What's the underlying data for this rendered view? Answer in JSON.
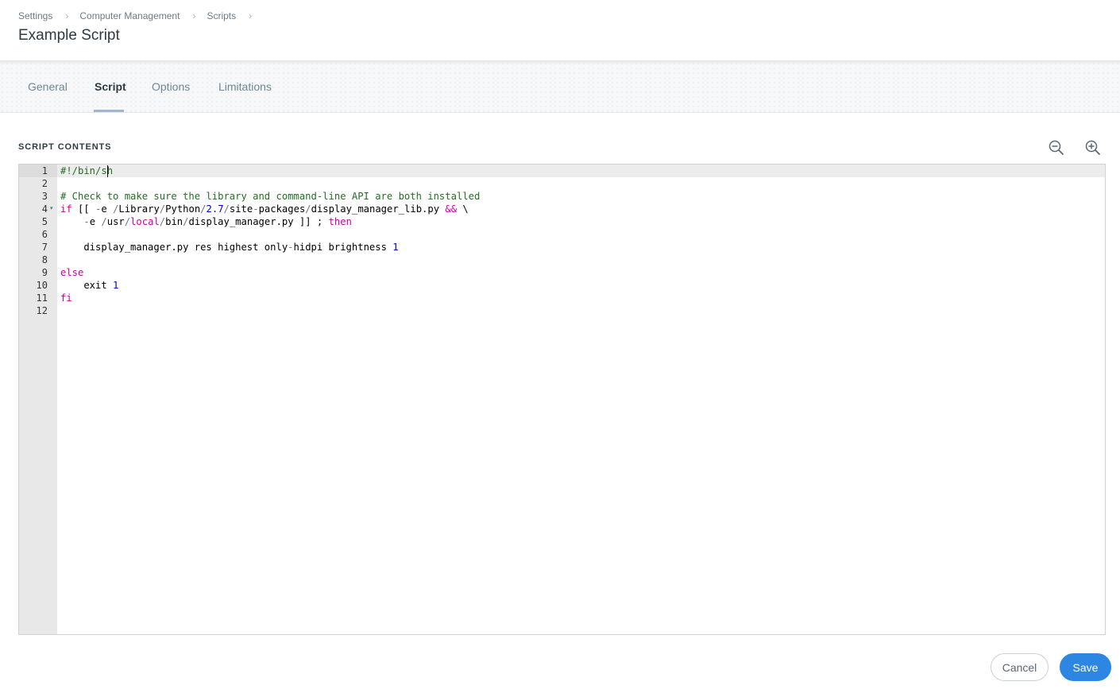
{
  "breadcrumb": {
    "items": [
      "Settings",
      "Computer Management",
      "Scripts"
    ]
  },
  "page": {
    "title": "Example Script"
  },
  "tabs": [
    {
      "label": "General",
      "active": false
    },
    {
      "label": "Script",
      "active": true
    },
    {
      "label": "Options",
      "active": false
    },
    {
      "label": "Limitations",
      "active": false
    }
  ],
  "section": {
    "label": "SCRIPT CONTENTS"
  },
  "toolbar": {
    "zoom_out_icon": "zoom-out-icon",
    "zoom_in_icon": "zoom-in-icon"
  },
  "editor": {
    "line_numbers": [
      "1",
      "2",
      "3",
      "4",
      "5",
      "6",
      "7",
      "8",
      "9",
      "10",
      "11",
      "12"
    ],
    "active_line": 1,
    "fold_marker_line": 4,
    "lines": [
      [
        {
          "t": "#!/bin/s",
          "c": "comment"
        },
        {
          "t": "CARET",
          "c": "caret"
        },
        {
          "t": "h",
          "c": "comment"
        }
      ],
      [],
      [
        {
          "t": "# Check to make sure the library and command-line API are both installed",
          "c": "comment"
        }
      ],
      [
        {
          "t": "if",
          "c": "keyword"
        },
        {
          "t": " [[ ",
          "c": "plain"
        },
        {
          "t": "-",
          "c": "op"
        },
        {
          "t": "e ",
          "c": "plain"
        },
        {
          "t": "/",
          "c": "op"
        },
        {
          "t": "Library",
          "c": "plain"
        },
        {
          "t": "/",
          "c": "op"
        },
        {
          "t": "Python",
          "c": "plain"
        },
        {
          "t": "/",
          "c": "op"
        },
        {
          "t": "2.7",
          "c": "number"
        },
        {
          "t": "/",
          "c": "op"
        },
        {
          "t": "site",
          "c": "plain"
        },
        {
          "t": "-",
          "c": "op"
        },
        {
          "t": "packages",
          "c": "plain"
        },
        {
          "t": "/",
          "c": "op"
        },
        {
          "t": "display_manager_lib.py ",
          "c": "plain"
        },
        {
          "t": "&&",
          "c": "keyword"
        },
        {
          "t": " \\",
          "c": "plain"
        }
      ],
      [
        {
          "t": "    ",
          "c": "plain"
        },
        {
          "t": "-",
          "c": "op"
        },
        {
          "t": "e ",
          "c": "plain"
        },
        {
          "t": "/",
          "c": "op"
        },
        {
          "t": "usr",
          "c": "plain"
        },
        {
          "t": "/",
          "c": "op"
        },
        {
          "t": "local",
          "c": "keyword"
        },
        {
          "t": "/",
          "c": "op"
        },
        {
          "t": "bin",
          "c": "plain"
        },
        {
          "t": "/",
          "c": "op"
        },
        {
          "t": "display_manager.py ]] ; ",
          "c": "plain"
        },
        {
          "t": "then",
          "c": "keyword"
        }
      ],
      [],
      [
        {
          "t": "    display_manager.py res highest only",
          "c": "plain"
        },
        {
          "t": "-",
          "c": "op"
        },
        {
          "t": "hidpi brightness ",
          "c": "plain"
        },
        {
          "t": "1",
          "c": "number"
        }
      ],
      [],
      [
        {
          "t": "else",
          "c": "keyword"
        }
      ],
      [
        {
          "t": "    exit ",
          "c": "plain"
        },
        {
          "t": "1",
          "c": "number"
        }
      ],
      [
        {
          "t": "fi",
          "c": "keyword"
        }
      ],
      []
    ]
  },
  "actions": {
    "cancel_label": "Cancel",
    "save_label": "Save"
  },
  "colors": {
    "primary": "#2d87e2",
    "comment": "#236e24",
    "keyword": "#c800a4",
    "number": "#0000cd",
    "tab_active_underline": "#9fb7cf"
  }
}
